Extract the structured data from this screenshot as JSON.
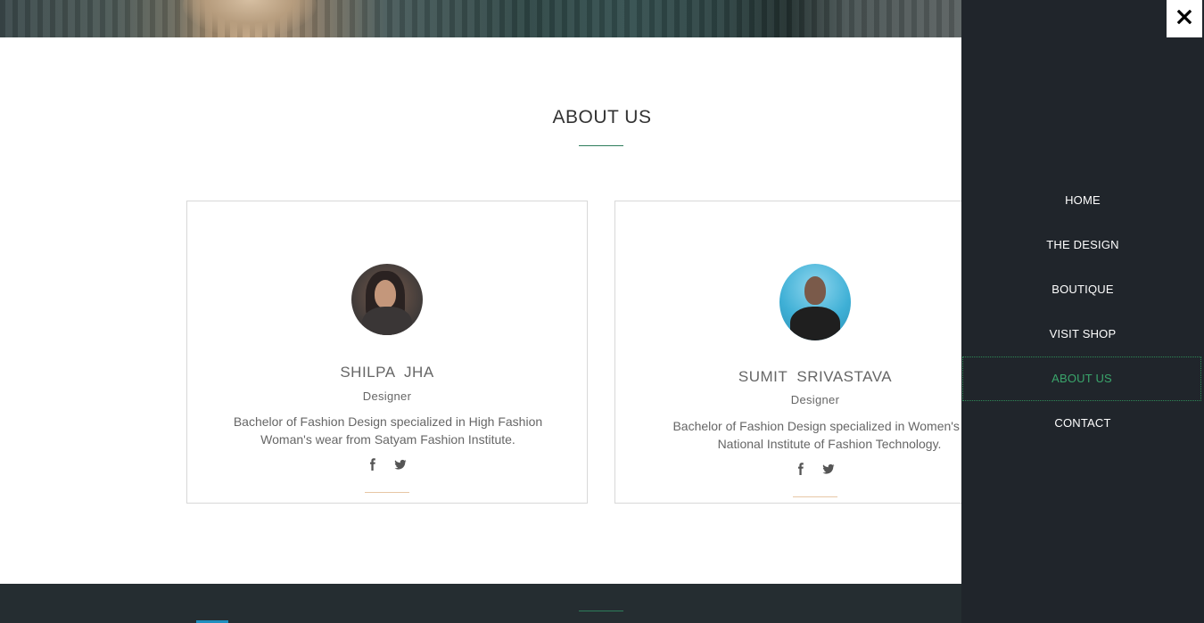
{
  "about": {
    "title": "ABOUT US",
    "members": [
      {
        "name": "SHILPA  JHA",
        "role": "Designer",
        "bio": "Bachelor of Fashion Design specialized in High Fashion Woman's wear from Satyam Fashion Institute.",
        "socials": [
          "facebook-icon",
          "twitter-icon"
        ]
      },
      {
        "name": "SUMIT  SRIVASTAVA",
        "role": "Designer",
        "bio_line1": "Bachelor of Fashion Design specialized in Women's wea",
        "bio_line2": "National Institute of Fashion Technology.",
        "socials": [
          "facebook-icon",
          "twitter-icon"
        ]
      }
    ]
  },
  "menu": {
    "close_icon": "close-icon",
    "items": [
      {
        "label": "HOME",
        "active": false
      },
      {
        "label": "THE DESIGN",
        "active": false
      },
      {
        "label": "BOUTIQUE",
        "active": false
      },
      {
        "label": "VISIT SHOP",
        "active": false
      },
      {
        "label": "ABOUT US",
        "active": true
      },
      {
        "label": "CONTACT",
        "active": false
      }
    ]
  },
  "colors": {
    "accent_green": "#3aa56b",
    "panel_bg": "#20252b",
    "footer_bg": "#252d31",
    "card_rule": "#e7c7a5"
  }
}
